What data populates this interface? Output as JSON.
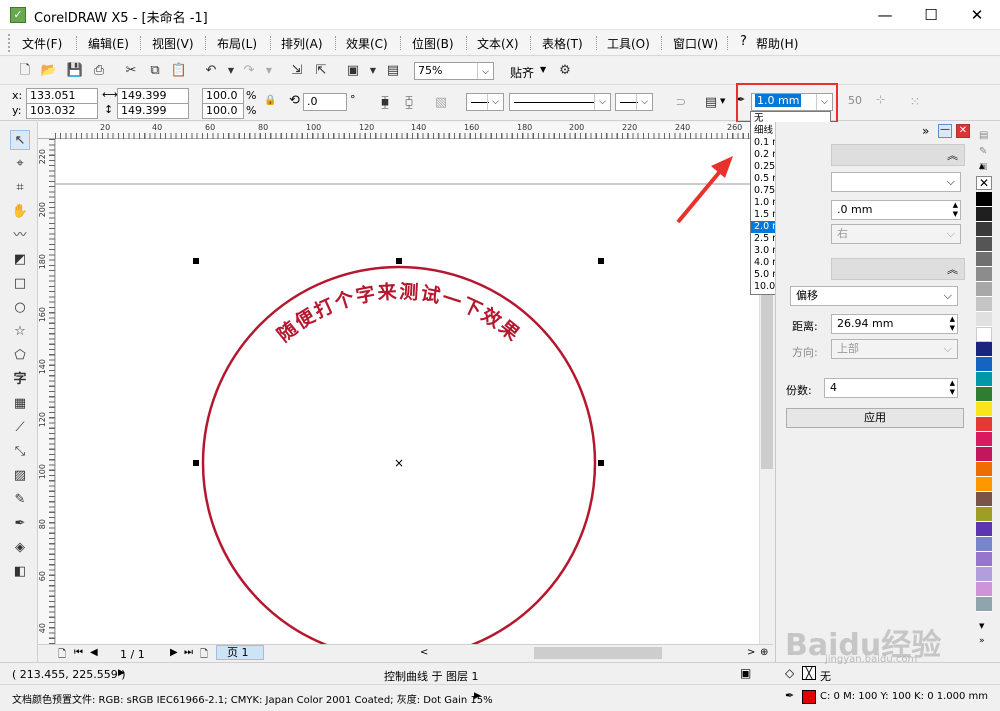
{
  "window": {
    "title": "CorelDRAW X5 - [未命名 -1]",
    "minimize": "—",
    "maximize": "☐",
    "close": "✕"
  },
  "menu": [
    "文件(F)",
    "编辑(E)",
    "视图(V)",
    "布局(L)",
    "排列(A)",
    "效果(C)",
    "位图(B)",
    "文本(X)",
    "表格(T)",
    "工具(O)",
    "窗口(W)",
    "帮助(H)"
  ],
  "toolbar": {
    "zoom": "75%",
    "snap": "贴齐"
  },
  "properties": {
    "x": "133.051 mm",
    "y": "103.032 mm",
    "width": "149.399 mm",
    "height": "149.399 mm",
    "scale_x": "100.0",
    "scale_y": "100.0",
    "percent": "%",
    "rotation": ".0",
    "degree": "°",
    "outline_width": "1.0 mm",
    "miter": "50"
  },
  "outline_dropdown": {
    "options": [
      "无",
      "细线",
      "0.1 mm",
      "0.2 mm",
      "0.25 mm",
      "0.5 mm",
      "0.75 mm",
      "1.0 mm",
      "1.5 mm",
      "2.0 mm",
      "2.5 mm",
      "3.0 mm",
      "4.0 mm",
      "5.0 mm",
      "10.0 mm"
    ],
    "highlighted": "2.0 mm"
  },
  "ruler": {
    "h_labels": [
      "20",
      "40",
      "60",
      "80",
      "100",
      "120",
      "140",
      "160",
      "180",
      "200",
      "220",
      "240",
      "260"
    ],
    "v_labels": [
      "220",
      "200",
      "180",
      "160",
      "140",
      "120",
      "100",
      "80",
      "60",
      "40"
    ]
  },
  "canvas": {
    "arc_text": "随便打个字来测试一下效果"
  },
  "docker": {
    "value_field": ".0 mm",
    "disabled_select": "右",
    "offset_select": "偏移",
    "distance_label": "距离:",
    "distance_value": "26.94 mm",
    "direction_label": "方向:",
    "direction_value": "上部",
    "copies_label": "份数:",
    "copies_value": "4",
    "apply_label": "应用"
  },
  "page_nav": {
    "counter": "1 / 1",
    "tab": "页 1"
  },
  "status": {
    "coords": "( 213.455, 225.559 )",
    "center": "控制曲线 于 图层 1",
    "color_profile": "文档颜色预置文件: RGB: sRGB IEC61966-2.1; CMYK: Japan Color 2001 Coated; 灰度: Dot Gain 15%",
    "fill_none": "无",
    "outline_info": "C: 0 M: 100 Y: 100 K: 0  1.000 mm"
  },
  "watermark": {
    "main": "Baidu经验",
    "sub": "jingyan.baidu.com"
  },
  "colors": {
    "circle": "#b5182e",
    "highlight_box": "#e8312c",
    "arrow": "#e8312c",
    "selection": "#0078d7",
    "palette": [
      "#000000",
      "#1f1f1f",
      "#3a3a3a",
      "#555555",
      "#707070",
      "#8c8c8c",
      "#a8a8a8",
      "#c4c4c4",
      "#e0e0e0",
      "#ffffff",
      "#1a237e",
      "#1565c0",
      "#0097a7",
      "#2e7d32",
      "#f9e51b",
      "#e53935",
      "#d81b60",
      "#c2185b",
      "#ef6c00",
      "#ff9800",
      "#795548",
      "#9e9d24",
      "#5e35b1",
      "#7986cb",
      "#9575cd",
      "#b39ddb",
      "#ce93d8",
      "#90a4ae"
    ]
  }
}
